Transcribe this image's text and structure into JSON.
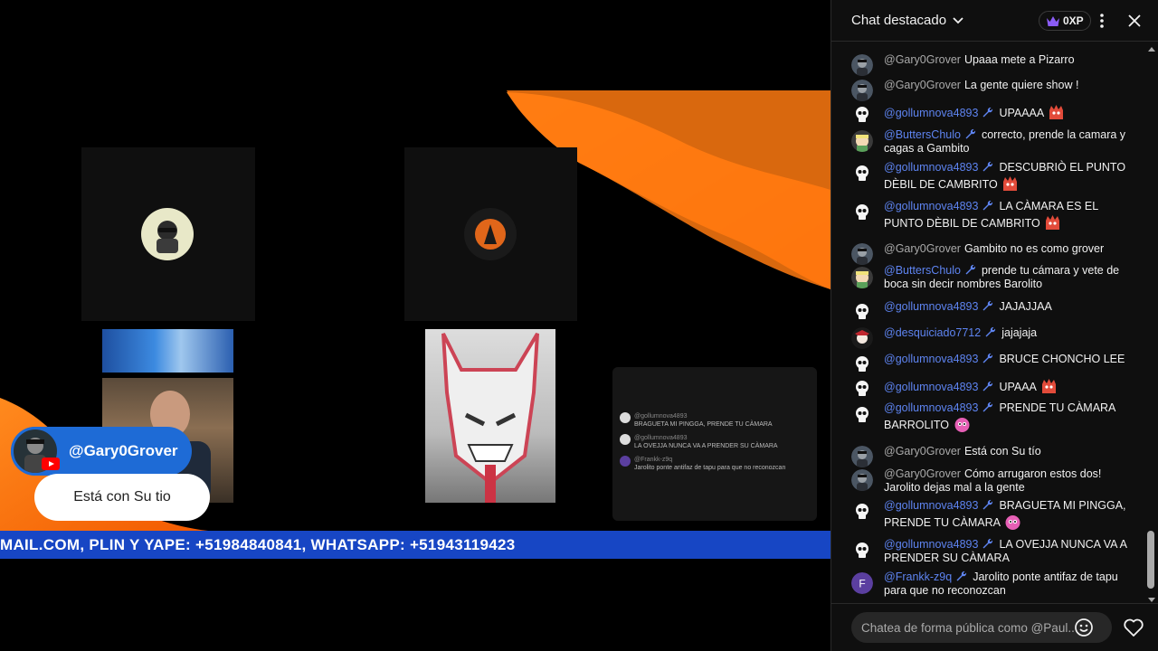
{
  "chat": {
    "title": "Chat destacado",
    "xp": "0XP",
    "input_placeholder": "Chatea de forma pública como @Paul...",
    "messages": [
      {
        "author": "@Gary0Grover",
        "text": "Upaaa mete a Pizarro"
      },
      {
        "author": "@Gary0Grover",
        "text": "La gente quiere show !"
      },
      {
        "author": "@gollumnova4893",
        "text": "UPAAAA"
      },
      {
        "author": "@ButtersChulo",
        "text": "correcto, prende la camara y cagas a Gambito"
      },
      {
        "author": "@gollumnova4893",
        "text": "DESCUBRIÒ EL PUNTO DÈBIL DE CAMBRITO"
      },
      {
        "author": "@gollumnova4893",
        "text": "LA CÀMARA ES EL PUNTO DÈBIL DE CAMBRITO"
      },
      {
        "author": "@Gary0Grover",
        "text": "Gambito no es como grover"
      },
      {
        "author": "@ButtersChulo",
        "text": "prende tu cámara y vete de boca sin decir nombres Barolito"
      },
      {
        "author": "@gollumnova4893",
        "text": "JAJAJJAA"
      },
      {
        "author": "@desquiciado7712",
        "text": "jajajaja"
      },
      {
        "author": "@gollumnova4893",
        "text": "BRUCE CHONCHO LEE"
      },
      {
        "author": "@gollumnova4893",
        "text": "UPAAA"
      },
      {
        "author": "@gollumnova4893",
        "text": "PRENDE TU CÀMARA BARROLITO"
      },
      {
        "author": "@Gary0Grover",
        "text": "Está con Su tío"
      },
      {
        "author": "@Gary0Grover",
        "text": "Cómo arrugaron estos dos! Jarolito dejas mal a la gente"
      },
      {
        "author": "@gollumnova4893",
        "text": "BRAGUETA MI PINGGA, PRENDE TU CÀMARA"
      },
      {
        "author": "@gollumnova4893",
        "text": "LA OVEJJA NUNCA VA A PRENDER SU CÀMARA"
      },
      {
        "author": "@Frankk-z9q",
        "text": "Jarolito ponte antifaz de tapu para que no reconozcan"
      }
    ]
  },
  "video": {
    "overlay_author": "@Gary0Grover",
    "overlay_message": "Está con Su tio",
    "ticker": "MAIL.COM, PLIN Y YAPE: +51984840841, WHATSAPP: +51943119423",
    "mini_chat": [
      {
        "author": "@gollumnova4893",
        "text": "BRAGUETA MI PINGGA, PRENDE TU CÀMARA"
      },
      {
        "author": "@gollumnova4893",
        "text": "LA OVEJJA NUNCA VA A PRENDER SU CÀMARA"
      },
      {
        "author": "@Frankk-z9q",
        "text": "Jarolito ponte antifaz de tapu para que no reconozcan"
      }
    ]
  }
}
